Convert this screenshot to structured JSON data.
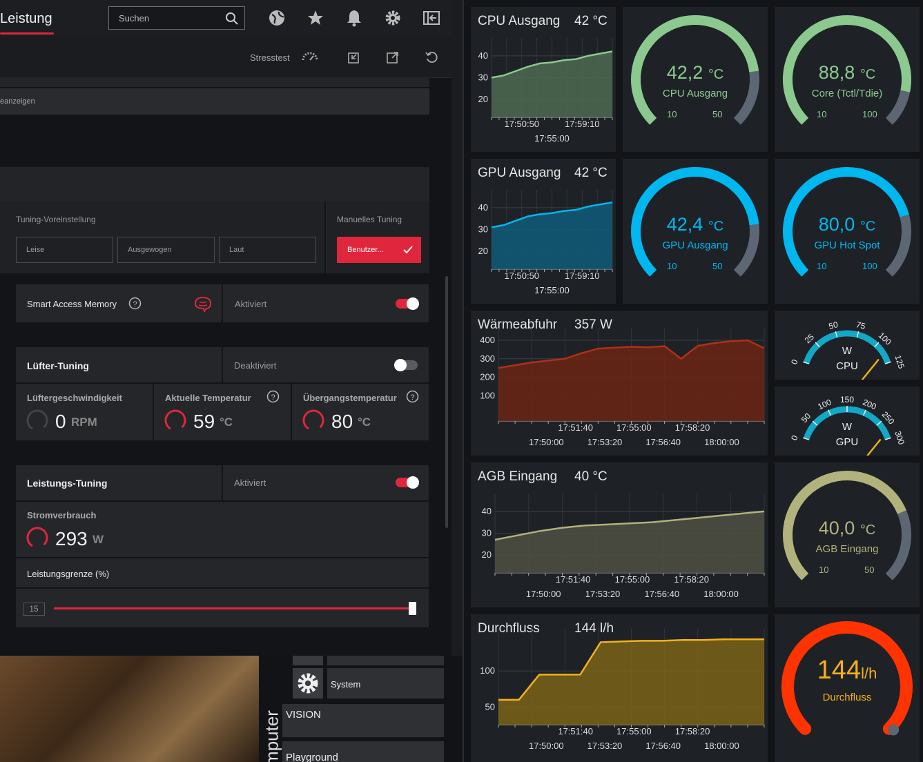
{
  "app": {
    "tab_title": "Leistung",
    "search_placeholder": "Suchen",
    "stresstest_label": "Stresstest",
    "section_hint": "eanzeigen"
  },
  "tuning": {
    "preset_label": "Tuning-Voreinstellung",
    "manual_label": "Manuelles Tuning",
    "presets": [
      "Leise",
      "Ausgewogen",
      "Laut"
    ],
    "custom_button": "Benutzer..."
  },
  "sam": {
    "label": "Smart Access Memory",
    "status": "Aktiviert"
  },
  "fan": {
    "title": "Lüfter-Tuning",
    "status": "Deaktiviert",
    "speed_label": "Lüftergeschwindigkeit",
    "speed_value": "0",
    "speed_unit": "RPM",
    "temp_label": "Aktuelle Temperatur",
    "temp_value": "59",
    "temp_unit": "°C",
    "junction_label": "Übergangstemperatur",
    "junction_value": "80",
    "junction_unit": "°C"
  },
  "power": {
    "title": "Leistungs-Tuning",
    "status": "Aktiviert",
    "draw_label": "Stromverbrauch",
    "draw_value": "293",
    "draw_unit": "W",
    "limit_label": "Leistungsgrenze (%)",
    "limit_value": "15",
    "limit_fraction": 1.0
  },
  "sidebar": {
    "system_label": "System",
    "vision_label": "VISION",
    "playground_label": "Playground",
    "vertical_label": "mputer"
  },
  "colors": {
    "accent": "#e0263c",
    "cpu": "#8cc98f",
    "gpu": "#00b7ef",
    "heat": "#b03018",
    "agb": "#b2b27c",
    "flow": "#f5b11c",
    "flow_gauge": "#ff3300"
  },
  "panels": {
    "cpu_chart": {
      "title": "CPU Ausgang",
      "value": "42 °C",
      "yticks": [
        "40",
        "30",
        "20"
      ],
      "xticks_top": [
        "17:50:50",
        "17:59:10"
      ],
      "xticks_bottom": [
        "17:55:00"
      ]
    },
    "gpu_chart": {
      "title": "GPU Ausgang",
      "value": "42 °C",
      "yticks": [
        "40",
        "30",
        "20"
      ],
      "xticks_top": [
        "17:50:50",
        "17:59:10"
      ],
      "xticks_bottom": [
        "17:55:00"
      ]
    },
    "heat_chart": {
      "title": "Wärmeabfuhr",
      "value": "357 W",
      "yticks": [
        "400",
        "300",
        "200",
        "100"
      ],
      "xticks_top": [
        "17:51:40",
        "17:55:00",
        "17:58:20"
      ],
      "xticks_bottom": [
        "17:50:00",
        "17:53:20",
        "17:56:40",
        "18:00:00"
      ]
    },
    "agb_chart": {
      "title": "AGB Eingang",
      "value": "40 °C",
      "yticks": [
        "40",
        "30",
        "20"
      ],
      "xticks_top": [
        "17:51:40",
        "17:55:00",
        "17:58:20"
      ],
      "xticks_bottom": [
        "17:50:00",
        "17:53:20",
        "17:56:40",
        "18:00:00"
      ]
    },
    "flow_chart": {
      "title": "Durchfluss",
      "value": "144 l/h",
      "yticks": [
        "100",
        "50"
      ],
      "xticks_top": [
        "17:51:40",
        "17:55:00",
        "17:58:20"
      ],
      "xticks_bottom": [
        "17:50:00",
        "17:53:20",
        "17:56:40",
        "18:00:00"
      ]
    }
  },
  "gauges": {
    "cpu_out": {
      "value": "42,2",
      "unit": "°C",
      "name": "CPU Ausgang",
      "min": "10",
      "max": "50",
      "fraction": 0.805
    },
    "cpu_core": {
      "value": "88,8",
      "unit": "°C",
      "name": "Core (Tctl/Tdie)",
      "min": "10",
      "max": "100",
      "fraction": 0.876
    },
    "gpu_out": {
      "value": "42,4",
      "unit": "°C",
      "name": "GPU Ausgang",
      "min": "10",
      "max": "50",
      "fraction": 0.81
    },
    "gpu_hot": {
      "value": "80,0",
      "unit": "°C",
      "name": "GPU Hot Spot",
      "min": "10",
      "max": "100",
      "fraction": 0.778
    },
    "agb": {
      "value": "40,0",
      "unit": "°C",
      "name": "AGB Eingang",
      "min": "10",
      "max": "50",
      "fraction": 0.75
    },
    "flow": {
      "value": "144",
      "unit": "l/h",
      "name": "Durchfluss",
      "fraction": 1.0
    }
  },
  "dials": {
    "cpu_w": {
      "unit": "W",
      "name": "CPU",
      "ticks": [
        "0",
        "25",
        "50",
        "75",
        "100",
        "125"
      ]
    },
    "gpu_w": {
      "unit": "W",
      "name": "GPU",
      "ticks": [
        "0",
        "50",
        "100",
        "150",
        "200",
        "250",
        "300"
      ]
    }
  },
  "chart_data": [
    {
      "type": "area",
      "title": "CPU Ausgang",
      "ylim": [
        15,
        45
      ],
      "x": [
        "17:50:50",
        "17:55:00",
        "17:59:10"
      ],
      "series": [
        {
          "name": "CPU Ausgang",
          "values": [
            30,
            31,
            33,
            35,
            36.5,
            37,
            38,
            38.5,
            40,
            41,
            42
          ]
        }
      ]
    },
    {
      "type": "area",
      "title": "GPU Ausgang",
      "ylim": [
        15,
        45
      ],
      "x": [
        "17:50:50",
        "17:55:00",
        "17:59:10"
      ],
      "series": [
        {
          "name": "GPU Ausgang",
          "values": [
            31,
            32,
            34,
            36,
            37,
            37.5,
            38.5,
            39,
            40.5,
            41.5,
            42.4
          ]
        }
      ]
    },
    {
      "type": "area",
      "title": "Wärmeabfuhr",
      "ylim": [
        0,
        430
      ],
      "x": [
        "17:50:00",
        "17:53:20",
        "17:56:40",
        "18:00:00"
      ],
      "series": [
        {
          "name": "Wärmeabfuhr",
          "values": [
            250,
            265,
            280,
            290,
            300,
            330,
            355,
            360,
            365,
            362,
            368,
            300,
            370,
            385,
            395,
            400,
            357
          ]
        }
      ]
    },
    {
      "type": "area",
      "title": "AGB Eingang",
      "ylim": [
        15,
        45
      ],
      "x": [
        "17:50:00",
        "17:53:20",
        "17:56:40",
        "18:00:00"
      ],
      "series": [
        {
          "name": "AGB Eingang",
          "values": [
            27,
            29,
            31,
            32.5,
            33.5,
            34,
            34.5,
            35,
            36,
            37,
            38,
            39,
            40
          ]
        }
      ]
    },
    {
      "type": "area",
      "title": "Durchfluss",
      "ylim": [
        35,
        150
      ],
      "x": [
        "17:50:00",
        "17:53:20",
        "17:56:40",
        "18:00:00"
      ],
      "series": [
        {
          "name": "Durchfluss",
          "values": [
            60,
            60,
            95,
            95,
            95,
            140,
            141,
            142,
            142,
            143,
            143,
            144,
            144,
            144
          ]
        }
      ]
    }
  ]
}
